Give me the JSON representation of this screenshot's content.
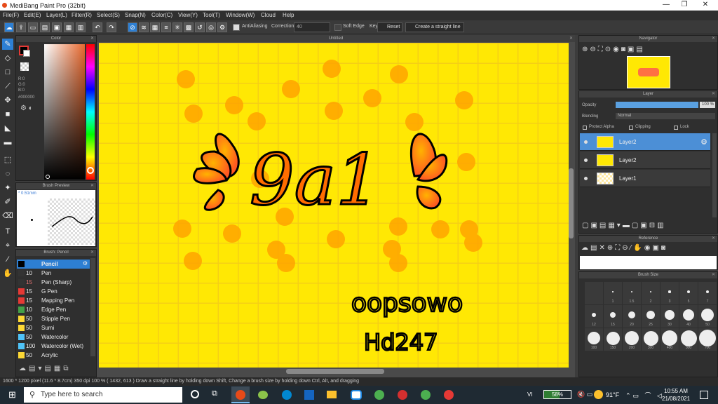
{
  "window": {
    "title": "MediBang Paint Pro (32bit)",
    "min": "—",
    "max": "❐",
    "close": "✕"
  },
  "menu": [
    "File(F)",
    "Edit(E)",
    "Layer(L)",
    "Filter(R)",
    "Select(S)",
    "Snap(N)",
    "Color(C)",
    "View(Y)",
    "Tool(T)",
    "Window(W)",
    "Cloud",
    "Help"
  ],
  "toolbar": {
    "antialias": "AntiAliasing",
    "correction_label": "Correction",
    "correction_value": "40",
    "soft_edge": "Soft Edge",
    "key": "Key",
    "reset": "Reset",
    "straight_line": "Create a straight line"
  },
  "color_panel": {
    "title": "Color",
    "r": "R:0",
    "g": "G:0",
    "b": "B:0",
    "hex": "#000000"
  },
  "brush_preview": {
    "title": "Brush Preview",
    "size": "0.51mm"
  },
  "brush_panel": {
    "title": "Brush: Pencil",
    "items": [
      {
        "size": "",
        "name": "Pencil",
        "color": "#000000"
      },
      {
        "size": "10",
        "name": "Pen",
        "color": "#333333"
      },
      {
        "size": "15",
        "name": "Pen (Sharp)",
        "color": "#333333"
      },
      {
        "size": "15",
        "name": "G Pen",
        "color": "#e53935"
      },
      {
        "size": "15",
        "name": "Mapping Pen",
        "color": "#e53935"
      },
      {
        "size": "10",
        "name": "Edge Pen",
        "color": "#43a047"
      },
      {
        "size": "50",
        "name": "Stipple Pen",
        "color": "#fdd835"
      },
      {
        "size": "50",
        "name": "Sumi",
        "color": "#fdd835"
      },
      {
        "size": "50",
        "name": "Watercolor",
        "color": "#4fc3f7"
      },
      {
        "size": "100",
        "name": "Watercolor (Wet)",
        "color": "#4fc3f7"
      },
      {
        "size": "50",
        "name": "Acrylic",
        "color": "#fdd835"
      }
    ]
  },
  "canvas": {
    "title": "Untitled",
    "art_title": "9a1",
    "text1": "oopsowo",
    "text2": "Hd247"
  },
  "navigator": {
    "title": "Navigator"
  },
  "layer_panel": {
    "title": "Layer",
    "opacity_label": "Opacity",
    "opacity_value": "100 %",
    "opacity_pct": 100,
    "blending_label": "Blending",
    "blending_value": "Normal",
    "protect_alpha": "Protect Alpha",
    "clipping": "Clipping",
    "lock": "Lock",
    "layers": [
      "Layer2",
      "Layer2",
      "Layer1"
    ]
  },
  "reference": {
    "title": "Reference"
  },
  "brush_size": {
    "title": "Brush Size",
    "row1": [
      "1",
      "1.5",
      "2",
      "3",
      "5",
      "7"
    ],
    "row2": [
      "12",
      "15",
      "20",
      "25",
      "30",
      "40",
      "50"
    ],
    "row3": [
      "100",
      "150",
      "200",
      "300",
      "400",
      "500",
      "700"
    ]
  },
  "status": "1600 * 1200 pixel   (11.6 * 8.7cm)   350 dpi   100 %   ( 1432, 613 )   Draw a straight line by holding down Shift, Change a brush size by holding down Ctrl, Alt, and dragging",
  "taskbar": {
    "search": "Type here to search",
    "battery": "58%",
    "weather": "91°F",
    "time": "10:55 AM",
    "date": "21/08/2021",
    "lang": "VI"
  }
}
